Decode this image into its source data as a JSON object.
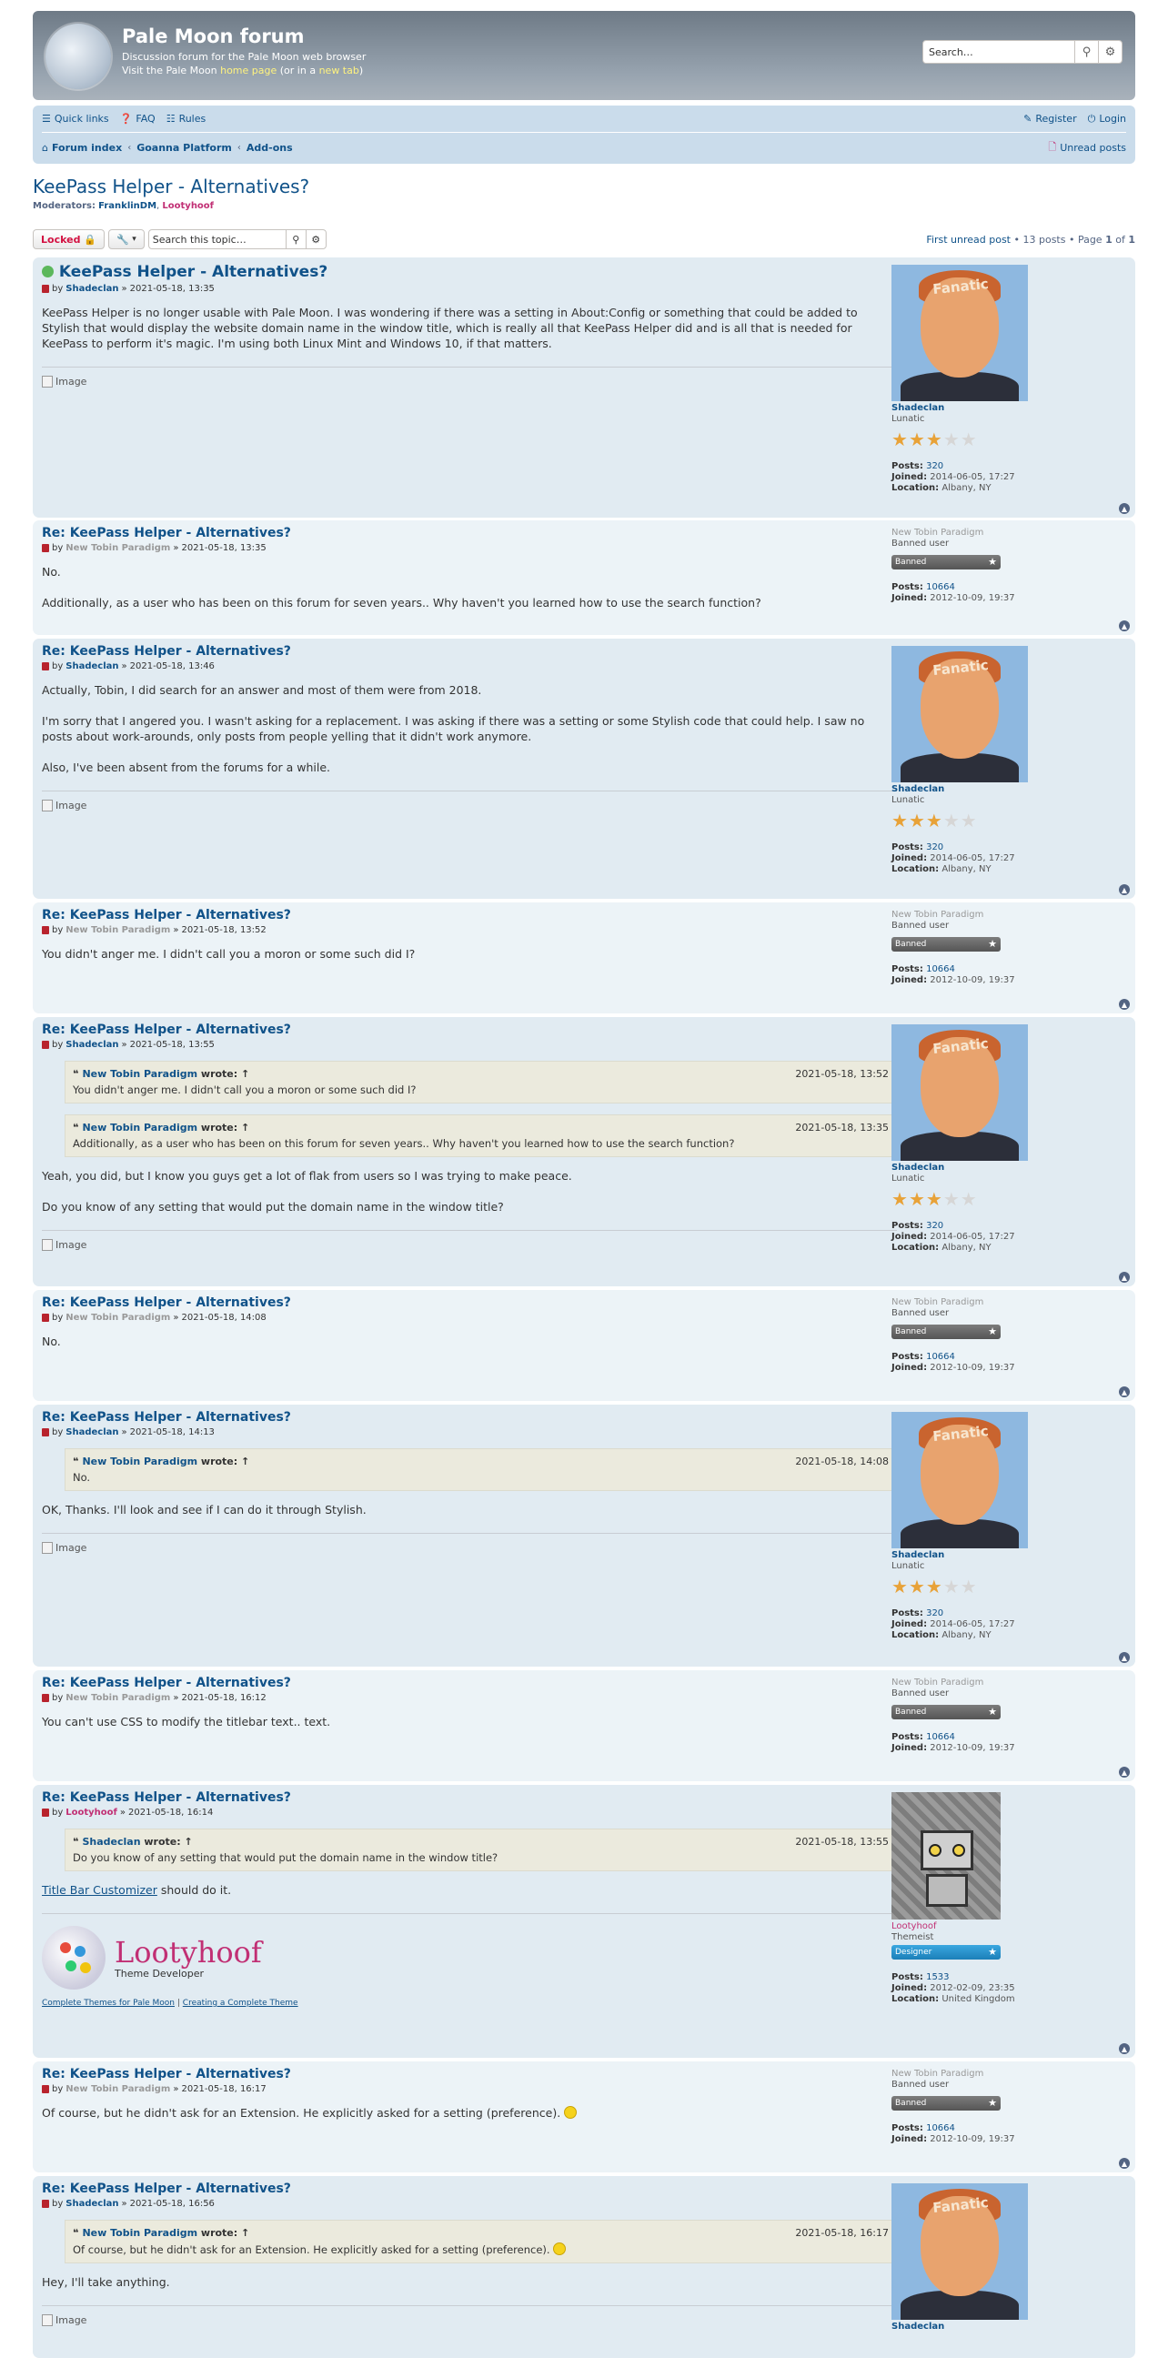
{
  "header": {
    "site_title": "Pale Moon forum",
    "site_desc": "Discussion forum for the Pale Moon web browser",
    "visit_pre": "Visit the Pale Moon",
    "home_page": "home page",
    "or_in": "(or in a",
    "new_tab": "new tab",
    "close": ")",
    "search_placeholder": "Search…"
  },
  "nav": {
    "quick_links": "Quick links",
    "faq": "FAQ",
    "rules": "Rules",
    "register": "Register",
    "login": "Login",
    "crumbs": [
      "Forum index",
      "Goanna Platform",
      "Add-ons"
    ],
    "unread": "Unread posts"
  },
  "topic": {
    "title": "KeePass Helper - Alternatives?",
    "mods_label": "Moderators:",
    "mod1": "FranklinDM",
    "mod2": "Lootyhoof",
    "locked": "Locked",
    "search_placeholder": "Search this topic…",
    "first_unread": "First unread post",
    "post_count": "• 13 posts • Page",
    "page": "1",
    "of": "of",
    "pages": "1"
  },
  "users": {
    "shade": {
      "name": "Shadeclan",
      "rank": "Lunatic",
      "posts": "320",
      "joined": "2014-06-05, 17:27",
      "location": "Albany, NY"
    },
    "tobin": {
      "name": "New Tobin Paradigm",
      "rank": "Banned user",
      "badge": "Banned",
      "posts": "10664",
      "joined": "2012-10-09, 19:37"
    },
    "looty": {
      "name": "Lootyhoof",
      "rank": "Themeist",
      "badge": "Designer",
      "posts": "1533",
      "joined": "2012-02-09, 23:35",
      "location": "United Kingdom"
    }
  },
  "labels": {
    "by": "by",
    "sep": "»",
    "posts": "Posts:",
    "joined": "Joined:",
    "location": "Location:",
    "wrote": "wrote:",
    "image": "Image",
    "up": "↑"
  },
  "posts": [
    {
      "title": "KeePass Helper - Alternatives?",
      "date": "2021-05-18, 13:35",
      "p1": "KeePass Helper is no longer usable with Pale Moon. I was wondering if there was a setting in About:Config or something that could be added to Stylish that would display the website domain name in the window title, which is really all that KeePass Helper did and is all that is needed for KeePass to perform it's magic. I'm using both Linux Mint and Windows 10, if that matters."
    },
    {
      "title": "Re: KeePass Helper - Alternatives?",
      "date": "2021-05-18, 13:35",
      "p1": "No.",
      "p2": "Additionally, as a user who has been on this forum for seven years.. Why haven't you learned how to use the search function?"
    },
    {
      "title": "Re: KeePass Helper - Alternatives?",
      "date": "2021-05-18, 13:46",
      "p1": "Actually, Tobin, I did search for an answer and most of them were from 2018.",
      "p2": "I'm sorry that I angered you. I wasn't asking for a replacement. I was asking if there was a setting or some Stylish code that could help. I saw no posts about work-arounds, only posts from people yelling that it didn't work anymore.",
      "p3": "Also, I've been absent from the forums for a while."
    },
    {
      "title": "Re: KeePass Helper - Alternatives?",
      "date": "2021-05-18, 13:52",
      "p1": "You didn't anger me. I didn't call you a moron or some such did I?"
    },
    {
      "title": "Re: KeePass Helper - Alternatives?",
      "date": "2021-05-18, 13:55",
      "q1_user": "New Tobin Paradigm",
      "q1_date": "2021-05-18, 13:52",
      "q1_text": "You didn't anger me. I didn't call you a moron or some such did I?",
      "q2_user": "New Tobin Paradigm",
      "q2_date": "2021-05-18, 13:35",
      "q2_text": "Additionally, as a user who has been on this forum for seven years.. Why haven't you learned how to use the search function?",
      "p1": "Yeah, you did, but I know you guys get a lot of flak from users so I was trying to make peace.",
      "p2": "Do you know of any setting that would put the domain name in the window title?"
    },
    {
      "title": "Re: KeePass Helper - Alternatives?",
      "date": "2021-05-18, 14:08",
      "p1": "No."
    },
    {
      "title": "Re: KeePass Helper - Alternatives?",
      "date": "2021-05-18, 14:13",
      "q1_user": "New Tobin Paradigm",
      "q1_date": "2021-05-18, 14:08",
      "q1_text": "No.",
      "p1": "OK, Thanks. I'll look and see if I can do it through Stylish."
    },
    {
      "title": "Re: KeePass Helper - Alternatives?",
      "date": "2021-05-18, 16:12",
      "p1": "You can't use CSS to modify the titlebar text.. text."
    },
    {
      "title": "Re: KeePass Helper - Alternatives?",
      "date": "2021-05-18, 16:14",
      "q1_user": "Shadeclan",
      "q1_date": "2021-05-18, 13:55",
      "q1_text": "Do you know of any setting that would put the domain name in the window title?",
      "link": "Title Bar Customizer",
      "p1": "should do it.",
      "sig_name": "Lootyhoof",
      "sig_sub": "Theme Developer",
      "sig_l1": "Complete Themes for Pale Moon",
      "sig_sep": "|",
      "sig_l2": "Creating a Complete Theme"
    },
    {
      "title": "Re: KeePass Helper - Alternatives?",
      "date": "2021-05-18, 16:17",
      "p1": "Of course, but he didn't ask for an Extension. He explicitly asked for a setting (preference)."
    },
    {
      "title": "Re: KeePass Helper - Alternatives?",
      "date": "2021-05-18, 16:56",
      "q1_user": "New Tobin Paradigm",
      "q1_date": "2021-05-18, 16:17",
      "q1_text": "Of course, but he didn't ask for an Extension. He explicitly asked for a setting (preference).",
      "p1": "Hey, I'll take anything."
    }
  ],
  "avatar_text": "Fanatic",
  "colors": {
    "link": "#105289",
    "banned": "#999999",
    "theme_author": "#c12f74",
    "locked": "#d31141"
  }
}
